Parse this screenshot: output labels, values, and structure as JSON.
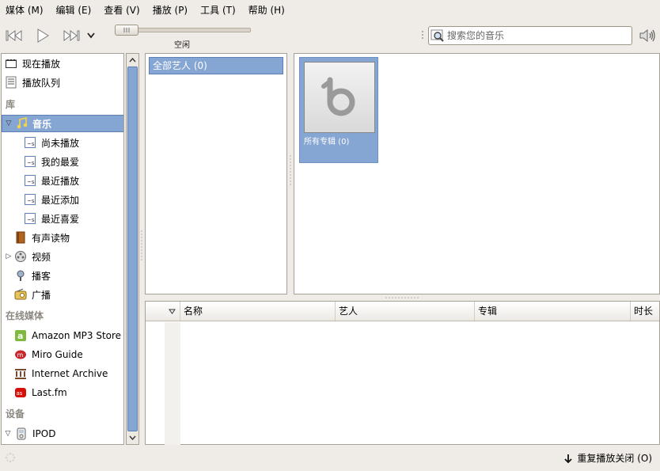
{
  "menubar": {
    "items": [
      "媒体 (M)",
      "编辑 (E)",
      "查看 (V)",
      "播放 (P)",
      "工具 (T)",
      "帮助 (H)"
    ]
  },
  "toolbar": {
    "status": "空闲",
    "search_placeholder": "搜索您的音乐"
  },
  "sidebar": {
    "now_playing": "现在播放",
    "play_queue": "播放队列",
    "library_header": "库",
    "music": "音乐",
    "playlists": [
      "尚未播放",
      "我的最爱",
      "最近播放",
      "最近添加",
      "最近喜爱"
    ],
    "audiobooks": "有声读物",
    "video": "视频",
    "podcasts": "播客",
    "radio": "广播",
    "online_header": "在线媒体",
    "online": [
      "Amazon MP3 Store",
      "Miro Guide",
      "Internet Archive",
      "Last.fm"
    ],
    "devices_header": "设备",
    "ipod": "IPOD"
  },
  "artists": {
    "all": "全部艺人 (0)"
  },
  "albums": {
    "all": "所有专辑 (0)"
  },
  "tracks": {
    "columns": [
      "名称",
      "艺人",
      "专辑",
      "时长"
    ]
  },
  "statusbar": {
    "repeat": "重复播放关闭 (O)"
  },
  "colors": {
    "selection": "#85a5d2",
    "window_bg": "#efebe7"
  }
}
